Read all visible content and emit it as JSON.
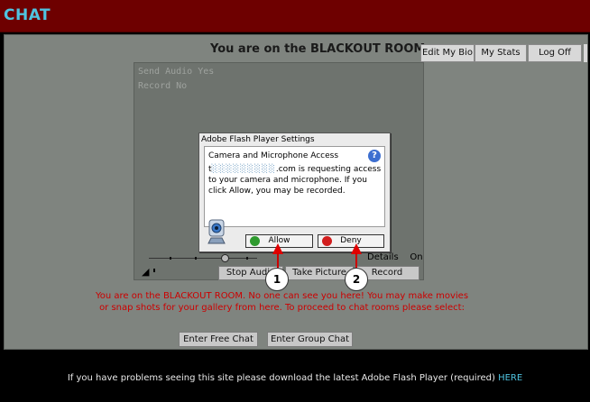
{
  "header": {
    "title": "CHAT"
  },
  "room": {
    "title": "You are on the BLACKOUT ROOM",
    "top_buttons": [
      "Edit My Bio",
      "My Stats",
      "Log Off"
    ]
  },
  "video": {
    "info": [
      "Send Audio Yes",
      "Record No"
    ],
    "details_label": "Details",
    "details_value": "On",
    "buttons": [
      "Stop Audio",
      "Take Picture",
      "Record"
    ]
  },
  "notice": "You are on the BLACKOUT ROOM. No one can see you here! You may make movies or snap shots for your gallery from here.  To proceed to chat rooms please select:",
  "chat_buttons": [
    "Enter Free Chat",
    "Enter Group Chat"
  ],
  "dialog": {
    "title": "Adobe Flash Player Settings",
    "heading": "Camera and Microphone Access",
    "domain_prefix": "t",
    "domain_suffix": ".com",
    "message": " is requesting access to your camera and microphone. If you click Allow, you may be recorded.",
    "allow_label": "Allow",
    "deny_label": "Deny"
  },
  "callouts": [
    "1",
    "2"
  ],
  "footer": {
    "text": "If you have problems seeing this site please download the latest Adobe Flash Player (required) ",
    "link": "HERE"
  },
  "colors": {
    "header_bg": "#6e0000",
    "accent": "#4fc3e0",
    "notice": "#cc0000"
  }
}
